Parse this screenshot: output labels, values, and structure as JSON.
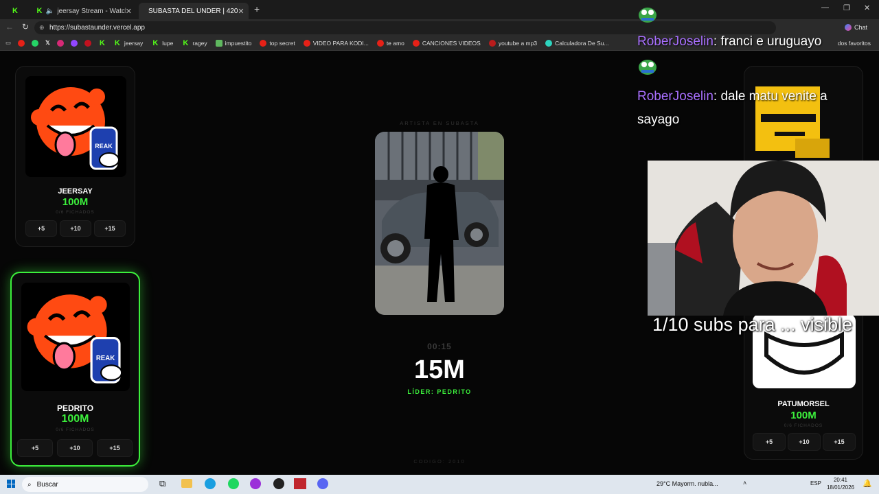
{
  "browser": {
    "tabs": [
      {
        "label": ""
      },
      {
        "label": "jeersay Stream - Watch Live o"
      },
      {
        "label": "SUBASTA DEL UNDER | 420"
      }
    ],
    "url": "https://subastaunder.vercel.app",
    "bookmarks": [
      "jeersay",
      "lupe",
      "ragey",
      "impuestito",
      "top secret",
      "VIDEO PARA KODI...",
      "te amo",
      "CANCIONES VIDEOS",
      "youtube a mp3",
      "Calculadora De Su...",
      "dos favoritos"
    ],
    "chat_label": "Chat"
  },
  "auction": {
    "section_label": "ARTISTA EN SUBASTA",
    "timer": "00:15",
    "amount": "15M",
    "leader": "LÍDER: PEDRITO",
    "code": "CODIGO: 2010"
  },
  "players": [
    {
      "name": "JEERSAY",
      "amount": "100M",
      "fichados": "0/6 FICHADOS",
      "buttons": [
        "+5",
        "+10",
        "+15"
      ]
    },
    {
      "name": "PEDRITO",
      "amount": "100M",
      "fichados": "0/6 FICHADOS",
      "buttons": [
        "+5",
        "+10",
        "+15"
      ]
    },
    {
      "name": "PATUMORSEL",
      "amount": "100M",
      "fichados": "0/6 FICHADOS",
      "buttons": [
        "+5",
        "+10",
        "+15"
      ]
    }
  ],
  "chat_overlay": {
    "messages": [
      {
        "user": "RoberJoselin",
        "text": "franci e uruguayo"
      },
      {
        "user": "RoberJoselin",
        "text": "dale matu venite a sayago"
      }
    ],
    "subs_text": "1/10 subs para ... visible"
  },
  "taskbar": {
    "search": "Buscar",
    "weather": "29°C  Mayorm. nubla...",
    "lang": "ESP",
    "time": "20:41",
    "date": "18/01/2026"
  },
  "colors": {
    "accent": "#3cf03c",
    "mascot": "#ff4a12"
  }
}
